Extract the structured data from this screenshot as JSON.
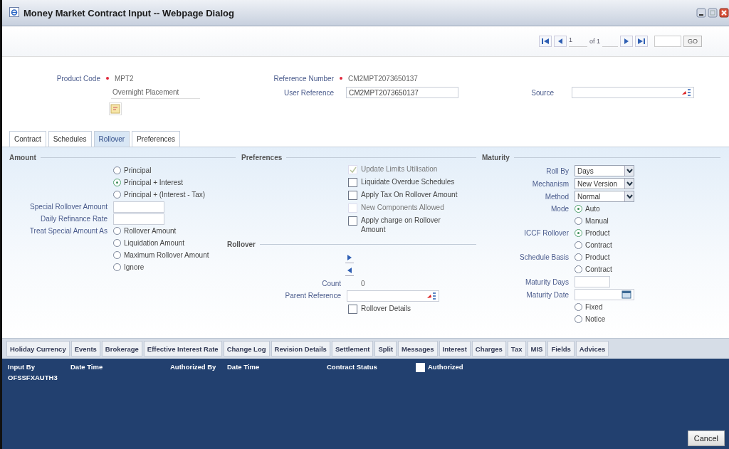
{
  "window": {
    "title": "Money Market Contract Input -- Webpage Dialog"
  },
  "pager": {
    "page": "1",
    "of": "of 1",
    "go": "GO"
  },
  "header": {
    "product_code": {
      "label": "Product Code",
      "value": "MPT2",
      "description": "Overnight Placement"
    },
    "reference_number": {
      "label": "Reference Number",
      "value": "CM2MPT2073650137"
    },
    "user_reference": {
      "label": "User Reference",
      "value": "CM2MPT2073650137"
    },
    "source": {
      "label": "Source"
    }
  },
  "tabs": [
    {
      "label": "Contract",
      "selected": false
    },
    {
      "label": "Schedules",
      "selected": false
    },
    {
      "label": "Rollover",
      "selected": true
    },
    {
      "label": "Preferences",
      "selected": false
    }
  ],
  "amount": {
    "title": "Amount",
    "options": [
      {
        "label": "Principal",
        "selected": false
      },
      {
        "label": "Principal + Interest",
        "selected": true
      },
      {
        "label": "Principal + (Interest - Tax)",
        "selected": false
      }
    ],
    "special_rollover_amount": {
      "label": "Special Rollover Amount"
    },
    "daily_refinance_rate": {
      "label": "Daily Refinance Rate"
    },
    "treat_special_amount_as": {
      "label": "Treat Special Amount As",
      "options": [
        {
          "label": "Rollover Amount",
          "selected": false
        },
        {
          "label": "Liquidation Amount",
          "selected": false
        },
        {
          "label": "Maximum Rollover Amount",
          "selected": false
        },
        {
          "label": "Ignore",
          "selected": false
        }
      ]
    }
  },
  "preferences": {
    "title": "Preferences",
    "checkboxes": [
      {
        "label": "Update Limits Utilisation",
        "checked": true,
        "disabled": true
      },
      {
        "label": "Liquidate Overdue Schedules",
        "checked": false,
        "disabled": false
      },
      {
        "label": "Apply Tax On Rollover Amount",
        "checked": false,
        "disabled": false
      },
      {
        "label": "New Components Allowed",
        "checked": false,
        "disabled": true
      },
      {
        "label": "Apply charge on Rollover Amount",
        "checked": false,
        "disabled": false
      }
    ]
  },
  "rollover": {
    "title": "Rollover",
    "count": {
      "label": "Count",
      "value": "0"
    },
    "parent_reference": {
      "label": "Parent Reference"
    },
    "rollover_details": {
      "label": "Rollover Details",
      "checked": false
    }
  },
  "maturity": {
    "title": "Maturity",
    "selects": [
      {
        "label": "Roll By",
        "value": "Days"
      },
      {
        "label": "Mechanism",
        "value": "New Version"
      },
      {
        "label": "Method",
        "value": "Normal"
      }
    ],
    "radio_groups": [
      {
        "label": "Mode",
        "options": [
          {
            "label": "Auto",
            "selected": true
          },
          {
            "label": "Manual",
            "selected": false
          }
        ]
      },
      {
        "label": "ICCF Rollover",
        "options": [
          {
            "label": "Product",
            "selected": true
          },
          {
            "label": "Contract",
            "selected": false
          }
        ]
      },
      {
        "label": "Schedule Basis",
        "options": [
          {
            "label": "Product",
            "selected": false
          },
          {
            "label": "Contract",
            "selected": false
          }
        ]
      }
    ],
    "maturity_days": {
      "label": "Maturity Days"
    },
    "maturity_date": {
      "label": "Maturity Date"
    },
    "type_options": [
      {
        "label": "Fixed",
        "selected": false
      },
      {
        "label": "Notice",
        "selected": false
      }
    ]
  },
  "bottom_tabs": [
    "Holiday Currency",
    "Events",
    "Brokerage",
    "Effective Interest Rate",
    "Change Log",
    "Revision Details",
    "Settlement",
    "Split",
    "Messages",
    "Interest",
    "Charges",
    "Tax",
    "MIS",
    "Fields",
    "Advices"
  ],
  "footer": {
    "input_by": {
      "label": "Input By",
      "value": "OFSSFXAUTH3"
    },
    "date_time_1": "Date Time",
    "authorized_by": "Authorized By",
    "date_time_2": "Date Time",
    "contract_status": "Contract Status",
    "authorized": {
      "label": "Authorized",
      "checked": false
    },
    "cancel": "Cancel"
  }
}
